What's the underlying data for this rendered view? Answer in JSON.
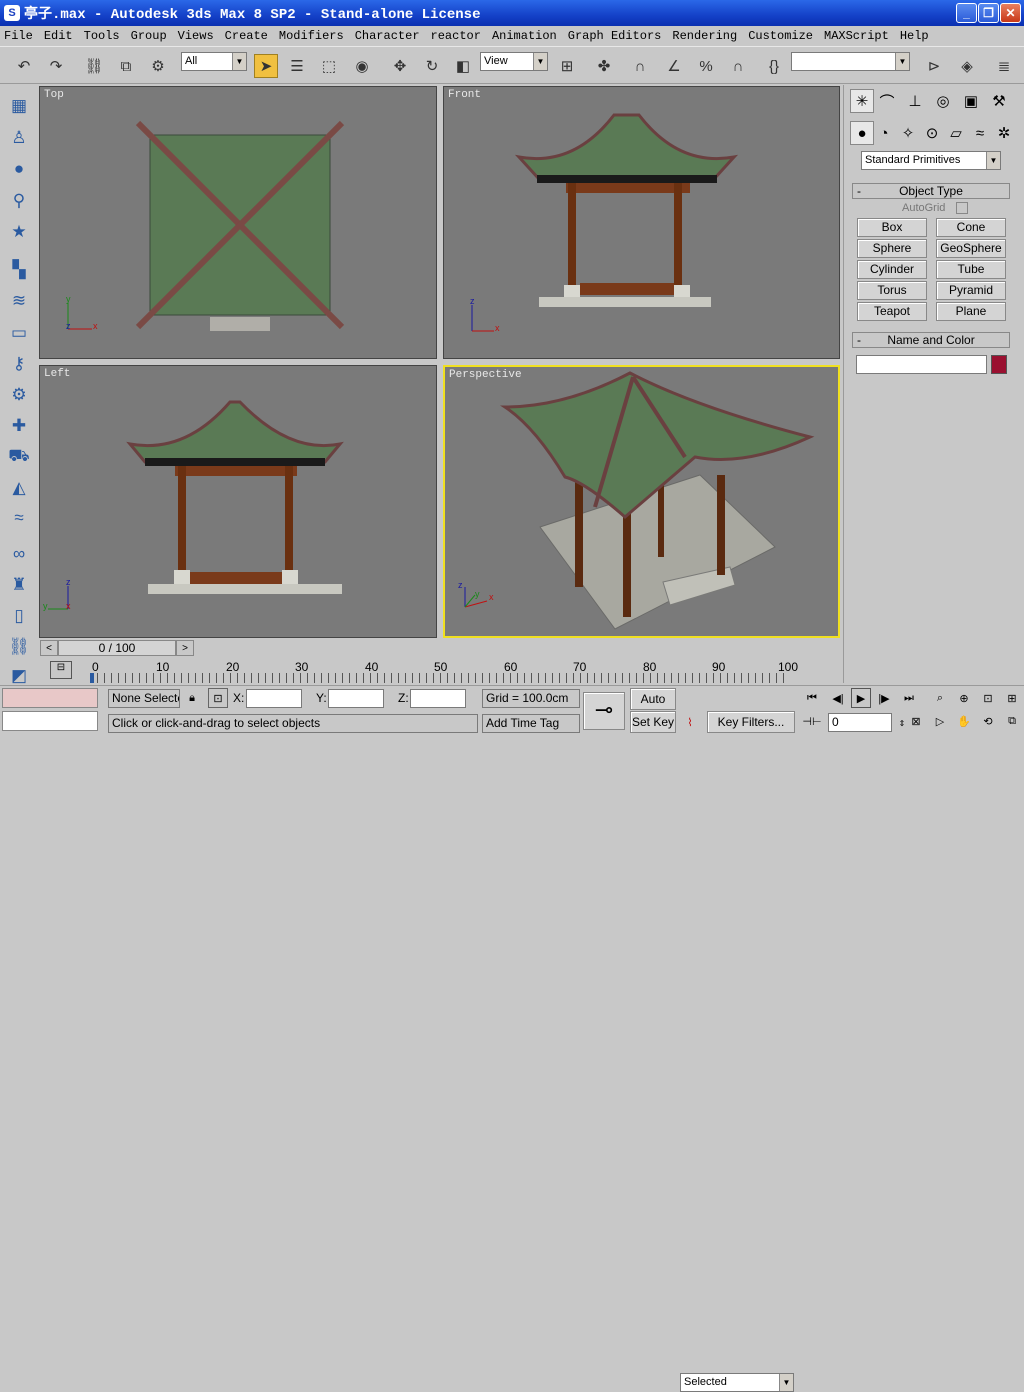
{
  "window": {
    "title": "亭子.max - Autodesk 3ds Max 8 SP2  - Stand-alone License"
  },
  "menu": [
    "File",
    "Edit",
    "Tools",
    "Group",
    "Views",
    "Create",
    "Modifiers",
    "Character",
    "reactor",
    "Animation",
    "Graph Editors",
    "Rendering",
    "Customize",
    "MAXScript",
    "Help"
  ],
  "toolbar": {
    "filter_value": "All",
    "coord_value": "View",
    "named_sel_value": ""
  },
  "viewports": {
    "top": "Top",
    "front": "Front",
    "left": "Left",
    "perspective": "Perspective"
  },
  "command_panel": {
    "category_value": "Standard Primitives",
    "object_type_title": "Object Type",
    "autogrid_label": "AutoGrid",
    "buttons": [
      "Box",
      "Cone",
      "Sphere",
      "GeoSphere",
      "Cylinder",
      "Tube",
      "Torus",
      "Pyramid",
      "Teapot",
      "Plane"
    ],
    "name_color_title": "Name and Color",
    "name_value": "",
    "color": "#9a1030"
  },
  "time": {
    "slider_label": "0 / 100",
    "ticks": [
      "0",
      "10",
      "20",
      "30",
      "40",
      "50",
      "60",
      "70",
      "80",
      "90",
      "100"
    ]
  },
  "status": {
    "selection": "None Selecte",
    "x_label": "X:",
    "y_label": "Y:",
    "z_label": "Z:",
    "grid": "Grid = 100.0cm",
    "prompt": "Click or click-and-drag to select objects",
    "add_time_tag": "Add Time Tag",
    "auto_key": "Auto Key",
    "set_key": "Set Key",
    "key_mode_value": "Selected",
    "key_filters": "Key Filters...",
    "frame_value": "0"
  }
}
